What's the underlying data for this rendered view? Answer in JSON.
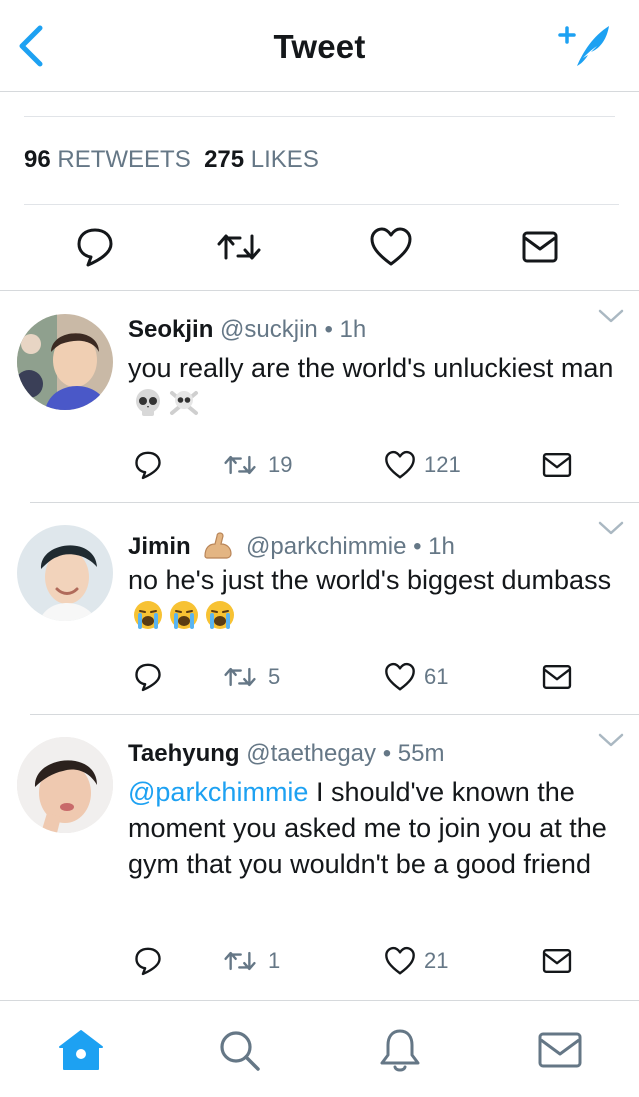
{
  "header": {
    "title": "Tweet"
  },
  "stats": {
    "retweets_count": "96",
    "retweets_label": "RETWEETS",
    "likes_count": "275",
    "likes_label": "LIKES"
  },
  "replies": [
    {
      "name": "Seokjin",
      "handle": "@suckjin",
      "time": "• 1h",
      "text": "you really are the world's unluckiest man",
      "retweets": "19",
      "likes": "121"
    },
    {
      "name": "Jimin",
      "handle": "@parkchimmie",
      "time": "• 1h",
      "text": "no he's just the world's biggest dumbass",
      "retweets": "5",
      "likes": "61"
    },
    {
      "name": "Taehyung",
      "handle": "@taethegay",
      "time": "• 55m",
      "mention": "@parkchimmie",
      "text": " I should've known the moment you asked me to join you at the gym that you wouldn't be a good friend",
      "retweets": "1",
      "likes": "21"
    }
  ],
  "colors": {
    "accent": "#1da1f2",
    "icon": "#14171a",
    "muted": "#657786"
  },
  "icons": {
    "back": "chevron-left-icon",
    "compose": "compose-feather-icon",
    "reply": "reply-icon",
    "retweet": "retweet-icon",
    "like": "heart-icon",
    "dm": "envelope-icon",
    "home": "home-icon",
    "search": "search-icon",
    "notifications": "bell-icon",
    "messages": "envelope-icon"
  }
}
